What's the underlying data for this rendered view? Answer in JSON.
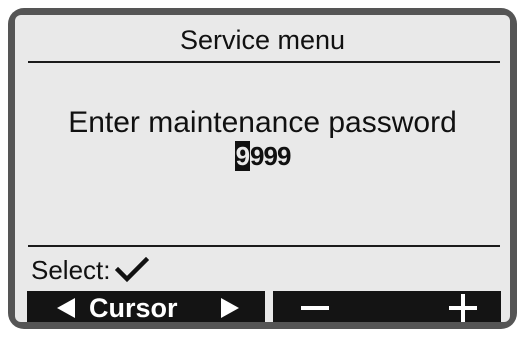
{
  "screen": {
    "title": "Service menu",
    "prompt": "Enter maintenance password",
    "password": {
      "cursor_digit": "9",
      "remaining_digits": "999"
    },
    "select": {
      "label": "Select:",
      "icon": "check-icon"
    }
  },
  "softkeys": {
    "cursor": {
      "label": "Cursor",
      "left_icon": "arrow-left-icon",
      "right_icon": "arrow-right-icon"
    },
    "adjust": {
      "minus_icon": "minus-icon",
      "plus_icon": "plus-icon"
    }
  },
  "colors": {
    "frame": "#555555",
    "screen_background": "#e9e9e9",
    "text": "#111111",
    "softkey_background": "#141414"
  }
}
